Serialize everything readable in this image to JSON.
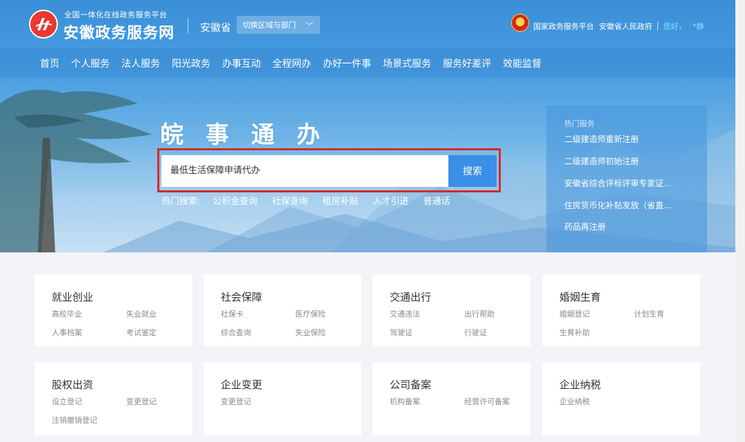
{
  "header": {
    "platform_sub": "全国一体化在线政务服务平台",
    "site_title": "安徽政务服务网",
    "province": "安徽省",
    "region_switch": "切换区域与部门",
    "links": [
      "国家政务服务平台",
      "安徽省人民政府"
    ],
    "greeting": "您好，",
    "login": "*静"
  },
  "nav": [
    "首页",
    "个人服务",
    "法人服务",
    "阳光政务",
    "办事互动",
    "全程网办",
    "办好一件事",
    "场景式服务",
    "服务好差评",
    "效能监督"
  ],
  "search": {
    "slogan": "皖事通办",
    "value": "最低生活保障申请代办",
    "button": "搜索",
    "hot_label": "热门搜索:",
    "hot_keywords": [
      "公积金查询",
      "社保查询",
      "租房补贴",
      "人才引进",
      "普通话"
    ]
  },
  "hot_services": {
    "title": "热门服务",
    "items": [
      "二级建造师重新注册",
      "二级建造师初始注册",
      "安徽省综合评标评审专家证...",
      "住房货币化补贴发放（省直...",
      "药品再注册"
    ]
  },
  "cards": [
    {
      "title": "就业创业",
      "links": [
        "高校毕业",
        "失业就业",
        "人事档案",
        "考试鉴定"
      ]
    },
    {
      "title": "社会保障",
      "links": [
        "社保卡",
        "医疗保险",
        "综合查询",
        "失业保险"
      ]
    },
    {
      "title": "交通出行",
      "links": [
        "交通违法",
        "出行帮助",
        "驾驶证",
        "行驶证"
      ]
    },
    {
      "title": "婚姻生育",
      "links": [
        "婚姻登记",
        "计划生育",
        "生育补助"
      ]
    },
    {
      "title": "股权出资",
      "links": [
        "设立登记",
        "变更登记",
        "注销撤销登记"
      ]
    },
    {
      "title": "企业变更",
      "links": [
        "变更登记"
      ]
    },
    {
      "title": "公司备案",
      "links": [
        "机构备案",
        "经营许可备案"
      ]
    },
    {
      "title": "企业纳税",
      "links": [
        "企业纳税"
      ]
    }
  ],
  "colors": {
    "brand_red": "#e8382f",
    "search_btn": "#3a8fe6",
    "highlight_frame": "#d42a2a",
    "greeting": "#7fe3ff"
  }
}
